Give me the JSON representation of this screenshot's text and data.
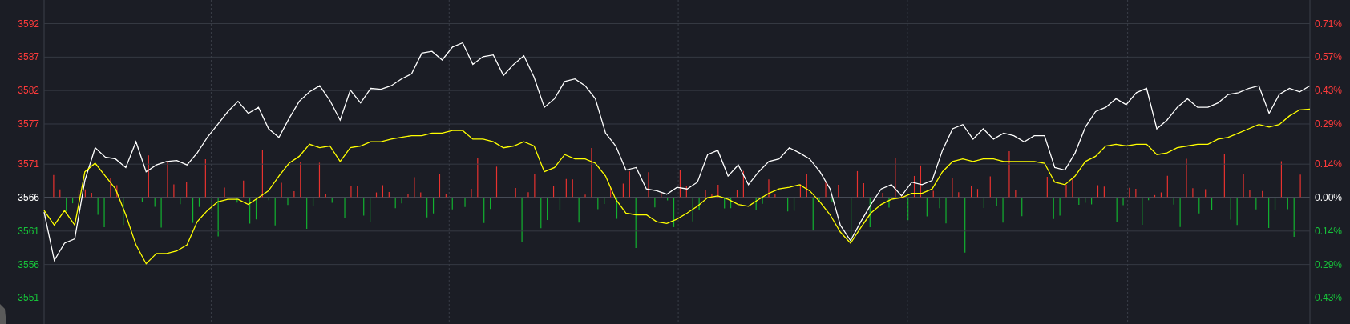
{
  "chart_data": {
    "type": "line",
    "ylim": [
      3547.11,
      3595.53
    ],
    "grid": true,
    "yticks": [
      3592,
      3587,
      3582,
      3577,
      3571,
      3566,
      3561,
      3556,
      3551
    ],
    "series": [
      {
        "color": "#ffffff",
        "values": [
          3563.82,
          3556.62,
          3559.19,
          3559.83,
          3568.57,
          3573.45,
          3572.04,
          3571.78,
          3570.5,
          3574.35,
          3569.86,
          3570.88,
          3571.4,
          3571.53,
          3570.88,
          3572.68,
          3575.0,
          3576.92,
          3578.85,
          3580.39,
          3578.59,
          3579.49,
          3576.28,
          3575.0,
          3577.82,
          3580.39,
          3581.81,
          3582.71,
          3580.52,
          3577.57,
          3582.06,
          3580.14,
          3582.32,
          3582.19,
          3582.71,
          3583.73,
          3584.5,
          3587.59,
          3587.85,
          3586.56,
          3588.49,
          3589.13,
          3585.92,
          3587.07,
          3587.33,
          3584.25,
          3585.92,
          3587.2,
          3583.99,
          3579.49,
          3580.78,
          3583.35,
          3583.73,
          3582.71,
          3580.78,
          3575.64,
          3573.71,
          3570.11,
          3570.5,
          3567.29,
          3567.03,
          3566.51,
          3567.54,
          3567.29,
          3568.31,
          3572.43,
          3573.07,
          3569.21,
          3570.88,
          3567.93,
          3569.86,
          3571.4,
          3571.78,
          3573.45,
          3572.68,
          3571.78,
          3569.86,
          3567.29,
          3561.89,
          3559.57,
          3562.4,
          3564.97,
          3567.29,
          3567.93,
          3566.26,
          3568.31,
          3567.93,
          3568.57,
          3573.07,
          3576.28,
          3576.92,
          3574.74,
          3576.28,
          3574.74,
          3575.64,
          3575.25,
          3574.35,
          3575.25,
          3575.25,
          3570.5,
          3570.11,
          3572.68,
          3576.54,
          3578.85,
          3579.49,
          3580.78,
          3579.88,
          3581.68,
          3582.32,
          3576.28,
          3577.57,
          3579.49,
          3580.78,
          3579.49,
          3579.49,
          3580.14,
          3581.42,
          3581.68,
          3582.32,
          3582.71,
          3578.59,
          3581.42,
          3582.32,
          3581.81,
          3582.71
        ]
      },
      {
        "color": "#ffff00",
        "values": [
          3564.07,
          3561.89,
          3564.07,
          3561.89,
          3569.86,
          3571.14,
          3569.21,
          3567.29,
          3563.43,
          3558.93,
          3556.11,
          3557.65,
          3557.65,
          3558.03,
          3558.93,
          3562.4,
          3564.07,
          3565.36,
          3565.74,
          3565.74,
          3564.97,
          3566.0,
          3567.03,
          3569.21,
          3571.14,
          3572.17,
          3573.97,
          3573.45,
          3573.71,
          3571.4,
          3573.45,
          3573.71,
          3574.35,
          3574.35,
          3574.74,
          3575.0,
          3575.25,
          3575.25,
          3575.64,
          3575.64,
          3576.02,
          3576.02,
          3574.74,
          3574.74,
          3574.35,
          3573.45,
          3573.71,
          3574.35,
          3573.71,
          3569.86,
          3570.5,
          3572.43,
          3571.78,
          3571.78,
          3571.14,
          3569.21,
          3565.74,
          3563.69,
          3563.43,
          3563.43,
          3562.4,
          3562.14,
          3562.79,
          3563.69,
          3564.71,
          3566.0,
          3566.26,
          3565.74,
          3564.97,
          3564.71,
          3565.74,
          3566.64,
          3567.29,
          3567.54,
          3567.93,
          3567.03,
          3565.36,
          3563.43,
          3560.86,
          3559.19,
          3561.5,
          3563.69,
          3564.97,
          3565.74,
          3566.0,
          3566.64,
          3566.64,
          3567.29,
          3569.86,
          3571.4,
          3571.78,
          3571.4,
          3571.78,
          3571.78,
          3571.4,
          3571.4,
          3571.4,
          3571.4,
          3571.14,
          3568.31,
          3567.93,
          3569.21,
          3571.4,
          3572.17,
          3573.71,
          3573.97,
          3573.71,
          3573.97,
          3573.97,
          3572.43,
          3572.68,
          3573.45,
          3573.71,
          3573.97,
          3573.97,
          3574.74,
          3575.0,
          3575.64,
          3576.28,
          3576.92,
          3576.54,
          3576.92,
          3578.21,
          3579.11,
          3579.24
        ]
      }
    ]
  },
  "right_axis_labels": [
    {
      "label": "0.71%",
      "kind": "up"
    },
    {
      "label": "0.57%",
      "kind": "up"
    },
    {
      "label": "0.43%",
      "kind": "up"
    },
    {
      "label": "0.29%",
      "kind": "up"
    },
    {
      "label": "0.14%",
      "kind": "up"
    },
    {
      "label": "0.00%",
      "kind": "flat"
    },
    {
      "label": "0.14%",
      "kind": "down"
    },
    {
      "label": "0.29%",
      "kind": "down"
    },
    {
      "label": "0.43%",
      "kind": "down"
    }
  ]
}
